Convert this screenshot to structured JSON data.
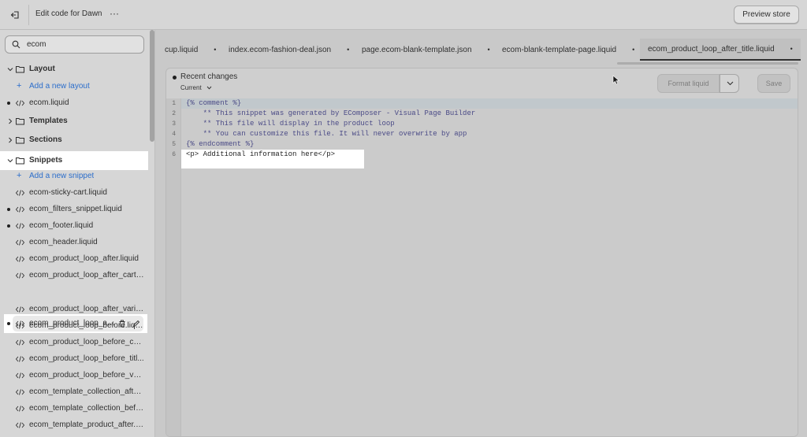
{
  "topbar": {
    "title": "Edit code for Dawn",
    "more_label": "···",
    "preview_label": "Preview store"
  },
  "sidebar": {
    "search_value": "ecom",
    "items": [
      {
        "type": "folder",
        "label": "Layout",
        "expanded": true
      },
      {
        "type": "add",
        "label": "Add a new layout"
      },
      {
        "type": "file",
        "label": "ecom.liquid",
        "modified": true
      },
      {
        "type": "folder",
        "label": "Templates",
        "expanded": false
      },
      {
        "type": "folder",
        "label": "Sections",
        "expanded": false
      },
      {
        "type": "folder",
        "label": "Snippets",
        "expanded": true
      },
      {
        "type": "add",
        "label": "Add a new snippet"
      },
      {
        "type": "file",
        "label": "ecom-sticky-cart.liquid",
        "modified": false
      },
      {
        "type": "file",
        "label": "ecom_filters_snippet.liquid",
        "modified": true
      },
      {
        "type": "file",
        "label": "ecom_footer.liquid",
        "modified": true
      },
      {
        "type": "file",
        "label": "ecom_header.liquid",
        "modified": false
      },
      {
        "type": "file",
        "label": "ecom_product_loop_after.liquid",
        "modified": false
      },
      {
        "type": "file",
        "label": "ecom_product_loop_after_cart_...",
        "modified": false
      },
      {
        "type": "file",
        "label": "ecom_product_loop_af...",
        "modified": true
      },
      {
        "type": "file",
        "label": "ecom_product_loop_after_varia...",
        "modified": false
      },
      {
        "type": "file",
        "label": "ecom_product_loop_before.liquid",
        "modified": false
      },
      {
        "type": "file",
        "label": "ecom_product_loop_before_car...",
        "modified": false
      },
      {
        "type": "file",
        "label": "ecom_product_loop_before_titl...",
        "modified": false
      },
      {
        "type": "file",
        "label": "ecom_product_loop_before_var...",
        "modified": false
      },
      {
        "type": "file",
        "label": "ecom_template_collection_after...",
        "modified": false
      },
      {
        "type": "file",
        "label": "ecom_template_collection_befo...",
        "modified": false
      },
      {
        "type": "file",
        "label": "ecom_template_product_after.li...",
        "modified": false
      }
    ]
  },
  "tabs": [
    {
      "label": "cup.liquid",
      "close": "•"
    },
    {
      "label": "index.ecom-fashion-deal.json",
      "close": "•"
    },
    {
      "label": "page.ecom-blank-template.json",
      "close": "•"
    },
    {
      "label": "ecom-blank-template-page.liquid",
      "close": "•"
    },
    {
      "label": "ecom_product_loop_after_title.liquid",
      "close": "•"
    }
  ],
  "editor": {
    "recent_changes": "Recent changes",
    "version": "Current",
    "format_label": "Format liquid",
    "save_label": "Save",
    "lines": [
      {
        "num": "1",
        "text": "{% comment %}"
      },
      {
        "num": "2",
        "text": "    ** This snippet was generated by EComposer - Visual Page Builder"
      },
      {
        "num": "3",
        "text": "    ** This file will display in the product loop"
      },
      {
        "num": "4",
        "text": "    ** You can customize this file. It will never overwrite by app"
      },
      {
        "num": "5",
        "text": "{% endcomment %}"
      },
      {
        "num": "6",
        "text": "<p> Additional information here</p>"
      }
    ]
  }
}
